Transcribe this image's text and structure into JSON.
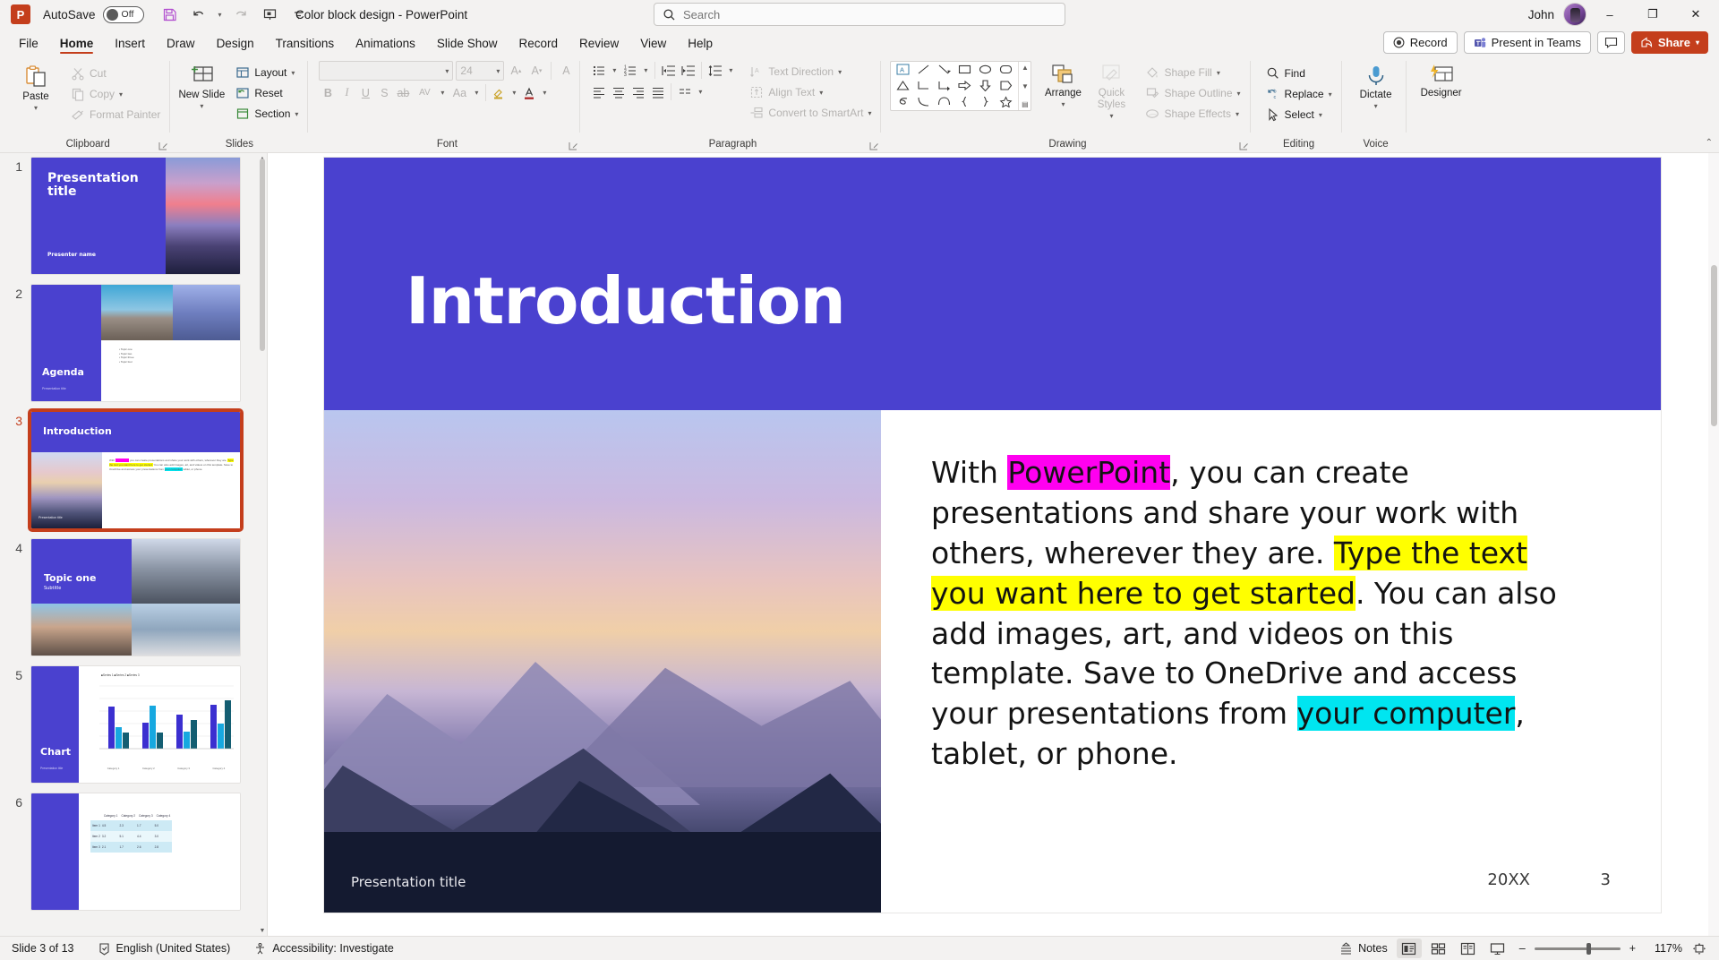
{
  "titlebar": {
    "app_logo": "P",
    "autosave_label": "AutoSave",
    "autosave_state": "Off",
    "doc_title": "Color block design  -  PowerPoint",
    "search_placeholder": "Search",
    "search_value": "",
    "user_name": "John",
    "qat": [
      {
        "name": "save-button",
        "icon": "save-icon"
      },
      {
        "name": "undo-button",
        "icon": "undo-icon"
      },
      {
        "name": "undo-dropdown",
        "icon": "chevron-down-icon"
      },
      {
        "name": "redo-button",
        "icon": "redo-icon"
      },
      {
        "name": "start-presentation-button",
        "icon": "present-icon"
      },
      {
        "name": "customize-qat-button",
        "icon": "chevron-down-icon"
      }
    ],
    "window_controls": {
      "minimize": "–",
      "maximize": "❐",
      "close": "✕"
    }
  },
  "ribbon": {
    "tabs": [
      {
        "label": "File",
        "active": false
      },
      {
        "label": "Home",
        "active": true
      },
      {
        "label": "Insert",
        "active": false
      },
      {
        "label": "Draw",
        "active": false
      },
      {
        "label": "Design",
        "active": false
      },
      {
        "label": "Transitions",
        "active": false
      },
      {
        "label": "Animations",
        "active": false
      },
      {
        "label": "Slide Show",
        "active": false
      },
      {
        "label": "Record",
        "active": false
      },
      {
        "label": "Review",
        "active": false
      },
      {
        "label": "View",
        "active": false
      },
      {
        "label": "Help",
        "active": false
      }
    ],
    "right_buttons": {
      "record": "Record",
      "present_in_teams": "Present in Teams",
      "comments": "",
      "share": "Share"
    },
    "groups": {
      "clipboard": {
        "label": "Clipboard",
        "paste": "Paste",
        "cut": "Cut",
        "copy": "Copy",
        "format_painter": "Format Painter"
      },
      "slides": {
        "label": "Slides",
        "new_slide": "New Slide",
        "layout": "Layout",
        "reset": "Reset",
        "section": "Section"
      },
      "font": {
        "label": "Font",
        "font_name": "",
        "font_size": "24",
        "bold": "B",
        "italic": "I",
        "underline": "U",
        "shadow": "S",
        "strikethrough": "ab",
        "char_spacing": "AV",
        "change_case": "Aa",
        "grow_font": "A",
        "shrink_font": "A",
        "clear_formatting": "A"
      },
      "paragraph": {
        "label": "Paragraph",
        "text_direction": "Text Direction",
        "align_text": "Align Text",
        "convert_to_smartart": "Convert to SmartArt"
      },
      "drawing": {
        "label": "Drawing",
        "arrange": "Arrange",
        "quick_styles": "Quick Styles",
        "shape_fill": "Shape Fill",
        "shape_outline": "Shape Outline",
        "shape_effects": "Shape Effects"
      },
      "editing": {
        "label": "Editing",
        "find": "Find",
        "replace": "Replace",
        "select": "Select"
      },
      "voice": {
        "label": "Voice",
        "dictate": "Dictate"
      },
      "designer": {
        "label": "",
        "designer": "Designer"
      }
    }
  },
  "thumbnails": [
    {
      "number": "1",
      "title": "Presentation title",
      "subtitle": "Presenter name",
      "type": "title",
      "selected": false
    },
    {
      "number": "2",
      "title": "Agenda",
      "items": [
        "Topic one",
        "Topic two",
        "Topic three",
        "Topic four"
      ],
      "type": "agenda",
      "selected": false
    },
    {
      "number": "3",
      "title": "Introduction",
      "type": "introduction",
      "selected": true
    },
    {
      "number": "4",
      "title": "Topic one",
      "subtitle": "Subtitle",
      "type": "topic",
      "selected": false
    },
    {
      "number": "5",
      "title": "Chart",
      "type": "chart",
      "selected": false
    },
    {
      "number": "6",
      "title": "",
      "type": "table",
      "selected": false
    }
  ],
  "slide": {
    "title": "Introduction",
    "footer": "Presentation title",
    "year": "20XX",
    "number": "3",
    "body": {
      "runs": [
        {
          "text": "With ",
          "hl": "none"
        },
        {
          "text": "PowerPoint",
          "hl": "magenta"
        },
        {
          "text": ", you can create presentations and share your work with others, wherever they are. ",
          "hl": "none"
        },
        {
          "text": "Type the text you want here to get started",
          "hl": "yellow"
        },
        {
          "text": ". You can also add images, art, and videos on this template. Save to OneDrive and access your presentations from ",
          "hl": "none"
        },
        {
          "text": "your computer",
          "hl": "cyan"
        },
        {
          "text": ", tablet, or phone.",
          "hl": "none"
        }
      ]
    },
    "highlight_colors": {
      "magenta": "#ff00f0",
      "yellow": "#ffff00",
      "cyan": "#00e5f0"
    },
    "band_color": "#4a41cf"
  },
  "status": {
    "slide_count": "Slide 3 of 13",
    "language": "English (United States)",
    "accessibility": "Accessibility: Investigate",
    "notes": "Notes",
    "zoom_level": "117%",
    "zoom_minus": "–",
    "zoom_plus": "+",
    "views": [
      "normal-view",
      "slide-sorter-view",
      "reading-view",
      "slideshow-view"
    ]
  }
}
